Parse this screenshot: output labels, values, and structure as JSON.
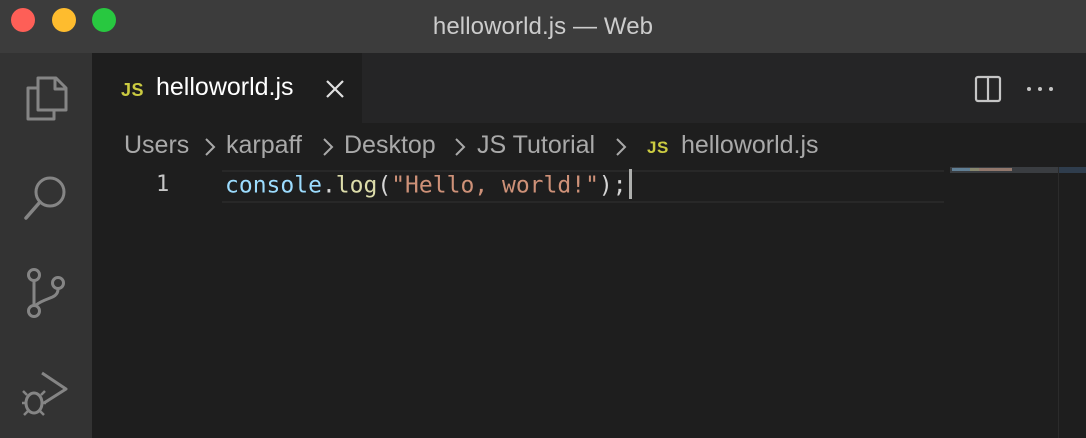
{
  "window": {
    "title": "helloworld.js — Web"
  },
  "activity_bar": {
    "items": [
      {
        "icon": "files-icon"
      },
      {
        "icon": "search-icon"
      },
      {
        "icon": "source-control-icon"
      },
      {
        "icon": "run-debug-icon"
      }
    ]
  },
  "tabs": [
    {
      "badge": "JS",
      "label": "helloworld.js",
      "active": true
    }
  ],
  "breadcrumb": {
    "items": [
      "Users",
      "karpaff",
      "Desktop",
      "JS Tutorial"
    ],
    "file_badge": "JS",
    "file": "helloworld.js"
  },
  "editor": {
    "line_number": "1",
    "tokens": {
      "object": "console",
      "dot": ".",
      "method": "log",
      "open_paren": "(",
      "string": "\"Hello, world!\"",
      "close": ");"
    }
  },
  "colors": {
    "titlebar": "#3c3c3c",
    "activity_bar": "#333333",
    "editor_bg": "#1e1e1e",
    "js_badge": "#cbcb41",
    "string": "#ce9178",
    "function": "#dcdcaa",
    "variable": "#9cdcfe"
  }
}
